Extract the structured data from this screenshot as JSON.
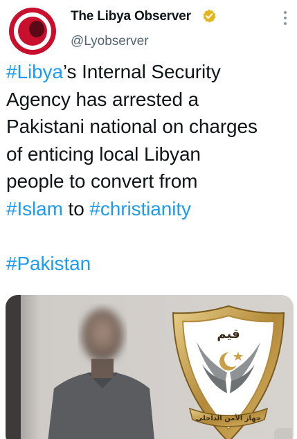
{
  "account": {
    "display_name": "The Libya Observer",
    "handle": "@Lyobserver",
    "verified_icon": "verified-badge-icon",
    "avatar_icon": "libya-observer-logo"
  },
  "menu": {
    "more_icon": "more-vertical-icon"
  },
  "tweet": {
    "line1_tag": "#Libya",
    "line1_rest": "’s Internal Security",
    "line2": "Agency has arrested a",
    "line3": "Pakistani national on charges",
    "line4": "of enticing local Libyan",
    "line5": "people to convert from",
    "line6_tag1": "#Islam",
    "line6_mid": " to ",
    "line6_tag2": "#christianity",
    "line8_tag": "#Pakistan"
  },
  "media": {
    "emblem_banner_text": "جهاز الأمن الداخلي",
    "emblem_top_text": "قيم",
    "description_icon": "photo-emblem"
  },
  "colors": {
    "link": "#1d9bf0",
    "text": "#0f1419",
    "secondary": "#536471",
    "verified": "#e2b719",
    "avatar_red": "#c8102e"
  }
}
